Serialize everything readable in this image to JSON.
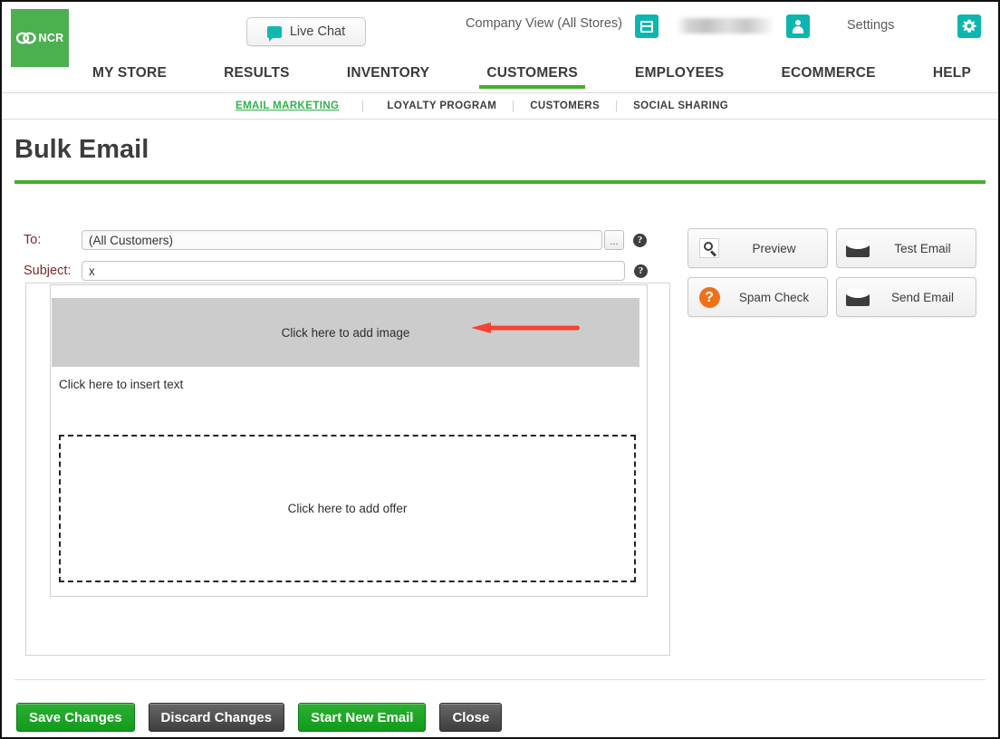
{
  "header": {
    "logo_text": "NCR",
    "live_chat_label": "Live Chat",
    "company_view": "Company View (All Stores)",
    "settings_label": "Settings",
    "store_icon_name": "store-icon",
    "user_icon_name": "user-icon",
    "gear_icon_name": "gear-icon"
  },
  "mainnav": {
    "items": [
      {
        "label": "MY STORE",
        "active": false
      },
      {
        "label": "RESULTS",
        "active": false
      },
      {
        "label": "INVENTORY",
        "active": false
      },
      {
        "label": "CUSTOMERS",
        "active": true
      },
      {
        "label": "EMPLOYEES",
        "active": false
      },
      {
        "label": "ECOMMERCE",
        "active": false
      },
      {
        "label": "HELP",
        "active": false
      }
    ],
    "active_accent": "#43b02a"
  },
  "subnav": {
    "items": [
      {
        "label": "EMAIL MARKETING",
        "active": true
      },
      {
        "label": "LOYALTY PROGRAM",
        "active": false
      },
      {
        "label": "CUSTOMERS",
        "active": false
      },
      {
        "label": "SOCIAL SHARING",
        "active": false
      }
    ],
    "active_color": "#2db24a"
  },
  "page": {
    "title": "Bulk Email",
    "rule_color": "#43b02a"
  },
  "form": {
    "to_label": "To:",
    "to_value": "(All Customers)",
    "to_placeholder": "",
    "subject_label": "Subject:",
    "subject_value": "x",
    "subject_placeholder": "",
    "ellipsis_label": "...",
    "help_glyph": "?",
    "label_color": "#7a2a2a"
  },
  "actions": {
    "buttons": [
      {
        "label": "Preview",
        "icon": "magnifier-icon"
      },
      {
        "label": "Test Email",
        "icon": "envelope-icon"
      },
      {
        "label": "Spam Check",
        "icon": "question-circle-icon"
      },
      {
        "label": "Send Email",
        "icon": "envelope-icon"
      }
    ],
    "spam_icon_color": "#f0701a"
  },
  "editor": {
    "image_placeholder": "Click here to add image",
    "text_placeholder": "Click here to insert text",
    "offer_placeholder": "Click here to add offer",
    "image_block_color": "#cccccc",
    "arrow_color": "#f44336"
  },
  "footer": {
    "buttons": [
      {
        "label": "Save Changes",
        "style": "green"
      },
      {
        "label": "Discard Changes",
        "style": "gray"
      },
      {
        "label": "Start New Email",
        "style": "green"
      },
      {
        "label": "Close",
        "style": "gray"
      }
    ]
  }
}
